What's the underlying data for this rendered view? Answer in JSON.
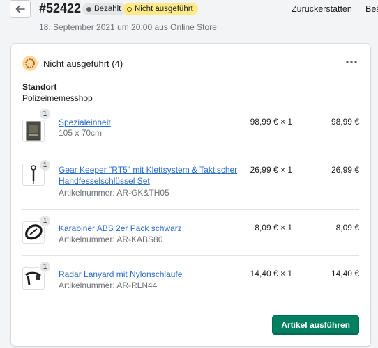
{
  "header": {
    "order_number": "#52422",
    "payment_status": "Bezahlt",
    "fulfillment_status": "Nicht ausgeführt",
    "subtitle": "18. September 2021 um 20:00 aus Online Store",
    "actions": [
      "Zurückerstatten",
      "Bea"
    ]
  },
  "card": {
    "title": "Nicht ausgeführt (4)",
    "location_label": "Standort",
    "location_value": "Polizeimemesshop",
    "items": [
      {
        "name": "Spezialeinheit",
        "sub": "105 x 70cm",
        "price": "98,99 € × 1",
        "total": "98,99 €",
        "quantity": "1",
        "icon": "poster-thumbnail"
      },
      {
        "name": "Gear Keeper \"RT5\" mit Klettsystem & Taktischer Handfesselschlüssel Set",
        "sub": "Artikelnummer: AR-GK&TH05",
        "price": "26,99 € × 1",
        "total": "26,99 €",
        "quantity": "1",
        "icon": "key-lanyard-thumbnail"
      },
      {
        "name": "Karabiner ABS 2er Pack schwarz",
        "sub": "Artikelnummer: AR-KABS80",
        "price": "8,09 € × 1",
        "total": "8,09 €",
        "quantity": "1",
        "icon": "carabiner-thumbnail"
      },
      {
        "name": "Radar Lanyard mit Nylonschlaufe",
        "sub": "Artikelnummer: AR-RLN44",
        "price": "14,40 € × 1",
        "total": "14,40 €",
        "quantity": "1",
        "icon": "lanyard-thumbnail"
      }
    ],
    "primary_action": "Artikel ausführen"
  },
  "colors": {
    "primary": "#008060",
    "link": "#2c6ecb",
    "badge_unfulfilled": "#ffea8a",
    "badge_paid": "#e4e5e7"
  }
}
